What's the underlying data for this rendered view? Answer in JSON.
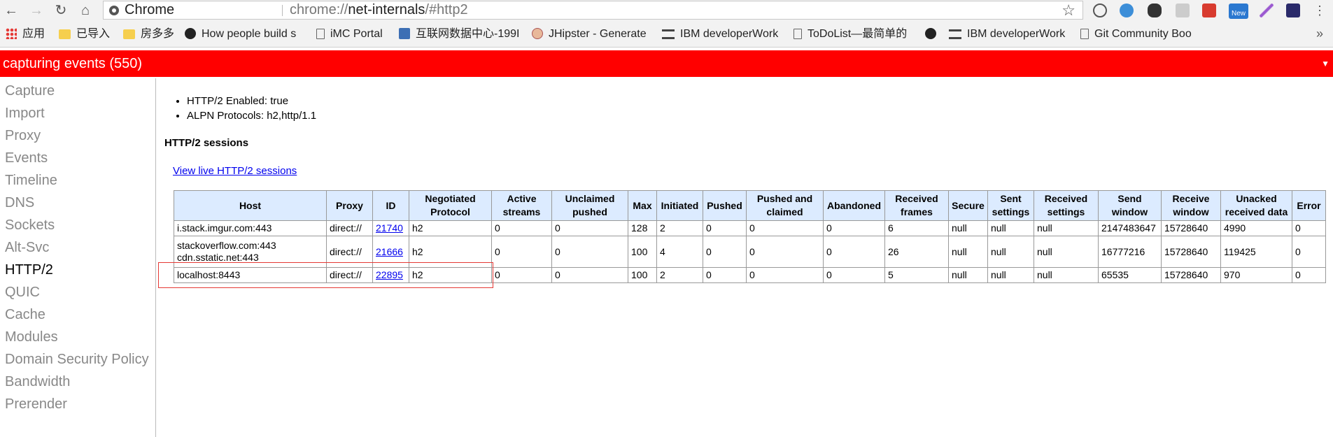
{
  "browser": {
    "tab_chip": "Chrome",
    "url_scheme": "chrome://",
    "url_host": "net-internals",
    "url_path": "/#http2",
    "extension_badge": "New"
  },
  "bookmarks": [
    {
      "label": "应用",
      "icon": "apps-grid-icon"
    },
    {
      "label": "已导入",
      "icon": "folder-icon"
    },
    {
      "label": "房多多",
      "icon": "folder-icon"
    },
    {
      "label": "How people build s",
      "icon": "github-icon"
    },
    {
      "label": "iMC Portal",
      "icon": "page-icon"
    },
    {
      "label": "互联网数据中心-199I",
      "icon": "site-icon"
    },
    {
      "label": "JHipster - Generate",
      "icon": "jhipster-icon"
    },
    {
      "label": "IBM developerWork",
      "icon": "ibm-icon"
    },
    {
      "label": "ToDoList—最简单的",
      "icon": "page-icon"
    },
    {
      "label": "",
      "icon": "github-icon"
    },
    {
      "label": "IBM developerWork",
      "icon": "ibm-icon"
    },
    {
      "label": "Git Community Boo",
      "icon": "page-icon"
    }
  ],
  "status": {
    "text": "capturing events (550)",
    "toggle_icon": "triangle-down-icon"
  },
  "sidebar": {
    "items": [
      "Capture",
      "Import",
      "Proxy",
      "Events",
      "Timeline",
      "DNS",
      "Sockets",
      "Alt-Svc",
      "HTTP/2",
      "QUIC",
      "Cache",
      "Modules",
      "Domain Security Policy",
      "Bandwidth",
      "Prerender"
    ],
    "active": "HTTP/2"
  },
  "http2": {
    "properties": [
      "HTTP/2 Enabled: true",
      "ALPN Protocols: h2,http/1.1"
    ],
    "sessions_title": "HTTP/2 sessions",
    "live_link": "View live HTTP/2 sessions",
    "columns": [
      "Host",
      "Proxy",
      "ID",
      "Negotiated Protocol",
      "Active streams",
      "Unclaimed pushed",
      "Max",
      "Initiated",
      "Pushed",
      "Pushed and claimed",
      "Abandoned",
      "Received frames",
      "Secure",
      "Sent settings",
      "Received settings",
      "Send window",
      "Receive window",
      "Unacked received data",
      "Error"
    ],
    "rows": [
      {
        "host": [
          "i.stack.imgur.com:443"
        ],
        "proxy": "direct://",
        "id": "21740",
        "protocol": "h2",
        "active": "0",
        "unclaimed": "0",
        "max": "128",
        "initiated": "2",
        "pushed": "0",
        "pushed_claimed": "0",
        "abandoned": "0",
        "received_frames": "6",
        "secure": "null",
        "sent_settings": "null",
        "received_settings": "null",
        "send_window": "2147483647",
        "receive_window": "15728640",
        "unacked": "4990",
        "error": "0"
      },
      {
        "host": [
          "stackoverflow.com:443",
          "cdn.sstatic.net:443"
        ],
        "proxy": "direct://",
        "id": "21666",
        "protocol": "h2",
        "active": "0",
        "unclaimed": "0",
        "max": "100",
        "initiated": "4",
        "pushed": "0",
        "pushed_claimed": "0",
        "abandoned": "0",
        "received_frames": "26",
        "secure": "null",
        "sent_settings": "null",
        "received_settings": "null",
        "send_window": "16777216",
        "receive_window": "15728640",
        "unacked": "119425",
        "error": "0"
      },
      {
        "host": [
          "localhost:8443"
        ],
        "proxy": "direct://",
        "id": "22895",
        "protocol": "h2",
        "active": "0",
        "unclaimed": "0",
        "max": "100",
        "initiated": "2",
        "pushed": "0",
        "pushed_claimed": "0",
        "abandoned": "0",
        "received_frames": "5",
        "secure": "null",
        "sent_settings": "null",
        "received_settings": "null",
        "send_window": "65535",
        "receive_window": "15728640",
        "unacked": "970",
        "error": "0"
      }
    ]
  },
  "colors": {
    "status_bar": "#ff0000",
    "header_bg": "#dcebff",
    "link": "#0000ee",
    "highlight": "#e53935"
  }
}
